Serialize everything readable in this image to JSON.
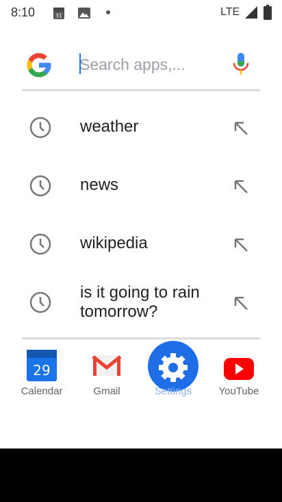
{
  "status_bar": {
    "time": "8:10",
    "calendar_day": "31",
    "network": "LTE"
  },
  "search": {
    "placeholder": "Search apps,..."
  },
  "suggestions": [
    {
      "text": "weather"
    },
    {
      "text": "news"
    },
    {
      "text": "wikipedia"
    },
    {
      "text_line1": "is it going to rain",
      "text_line2": "tomorrow?"
    }
  ],
  "dock": [
    {
      "label": "Calendar",
      "day": "29"
    },
    {
      "label": "Gmail"
    },
    {
      "label": "Settings"
    },
    {
      "label": "YouTube"
    }
  ],
  "colors": {
    "accent": "#1a73e8",
    "google_blue": "#4285f4",
    "google_red": "#ea4335",
    "google_yellow": "#fbbc05",
    "google_green": "#34a853",
    "settings_blue": "#1e6ee8",
    "youtube_red": "#ff0000"
  }
}
